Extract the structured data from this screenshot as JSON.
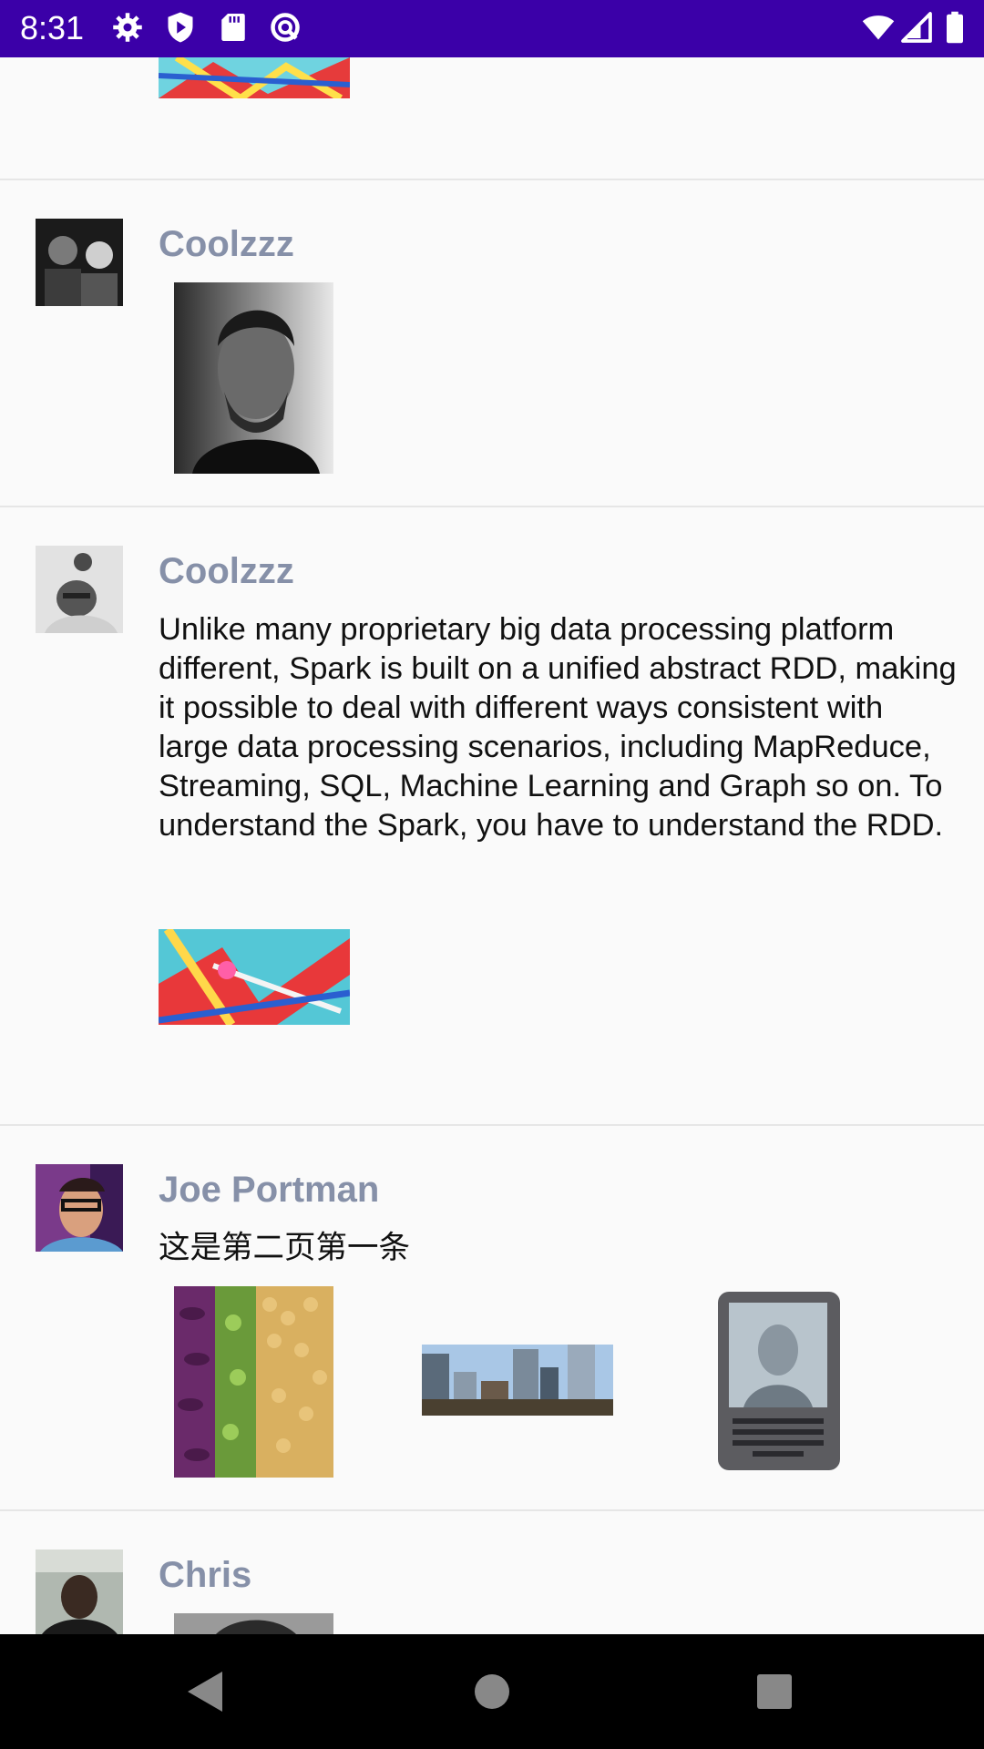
{
  "status_bar": {
    "time": "8:31",
    "icons": [
      "gear-icon",
      "play-protect-icon",
      "sd-card-icon",
      "sync-icon",
      "wifi-icon",
      "signal-icon",
      "battery-icon"
    ],
    "background": "#3b00a8"
  },
  "feed": {
    "name_color": "#8690a8",
    "posts": [
      {
        "name": "Coolzzz"
      },
      {
        "name": "Coolzzz",
        "text": "Unlike many proprietary big data processing platform different, Spark is built on a unified abstract RDD, making it possible to deal with different ways consistent with large data processing scenarios, including MapReduce, Streaming, SQL, Machine Learning and Graph so on. To understand the Spark, you have to understand the RDD."
      },
      {
        "name": "Joe Portman",
        "text": "这是第二页第一条"
      },
      {
        "name": "Chris"
      }
    ]
  },
  "nav_bar": {
    "buttons": [
      "back-icon",
      "home-icon",
      "recents-icon"
    ]
  }
}
